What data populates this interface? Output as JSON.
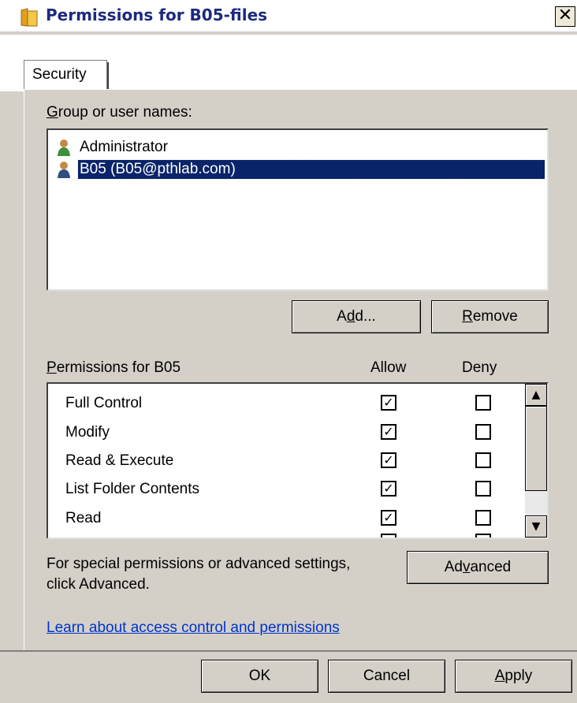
{
  "window": {
    "title": "Permissions for B05-files",
    "close_glyph": "✕"
  },
  "tabs": [
    {
      "label": "Security"
    }
  ],
  "group_section": {
    "label_prefix": "",
    "label_accel": "G",
    "label_rest": "roup or user names:",
    "users": [
      {
        "name": "Administrator",
        "icon": "user-icon",
        "selected": false
      },
      {
        "name": "B05 (B05@pthlab.com)",
        "icon": "user-icon",
        "selected": true
      }
    ],
    "add_button": {
      "pre": "A",
      "accel": "d",
      "post": "d..."
    },
    "remove_button": {
      "pre": "",
      "accel": "R",
      "post": "emove"
    }
  },
  "permissions": {
    "label_accel": "P",
    "label_rest": "ermissions for B05",
    "allow_header": "Allow",
    "deny_header": "Deny",
    "rows": [
      {
        "name": "Full Control",
        "allow": true,
        "deny": false
      },
      {
        "name": "Modify",
        "allow": true,
        "deny": false
      },
      {
        "name": "Read & Execute",
        "allow": true,
        "deny": false
      },
      {
        "name": "List Folder Contents",
        "allow": true,
        "deny": false
      },
      {
        "name": "Read",
        "allow": true,
        "deny": false
      }
    ]
  },
  "advanced": {
    "text_line1": "For special permissions or advanced settings,",
    "text_line2": "click Advanced.",
    "button": {
      "pre": "Ad",
      "accel": "v",
      "post": "anced"
    }
  },
  "learn_link": "Learn about access control and permissions",
  "footer": {
    "ok": "OK",
    "cancel": "Cancel",
    "apply": {
      "pre": "",
      "accel": "A",
      "post": "pply"
    }
  },
  "colors": {
    "selection": "#0a246a",
    "link": "#0033cc",
    "title": "#1c2a7e",
    "face": "#d4d0c8"
  }
}
